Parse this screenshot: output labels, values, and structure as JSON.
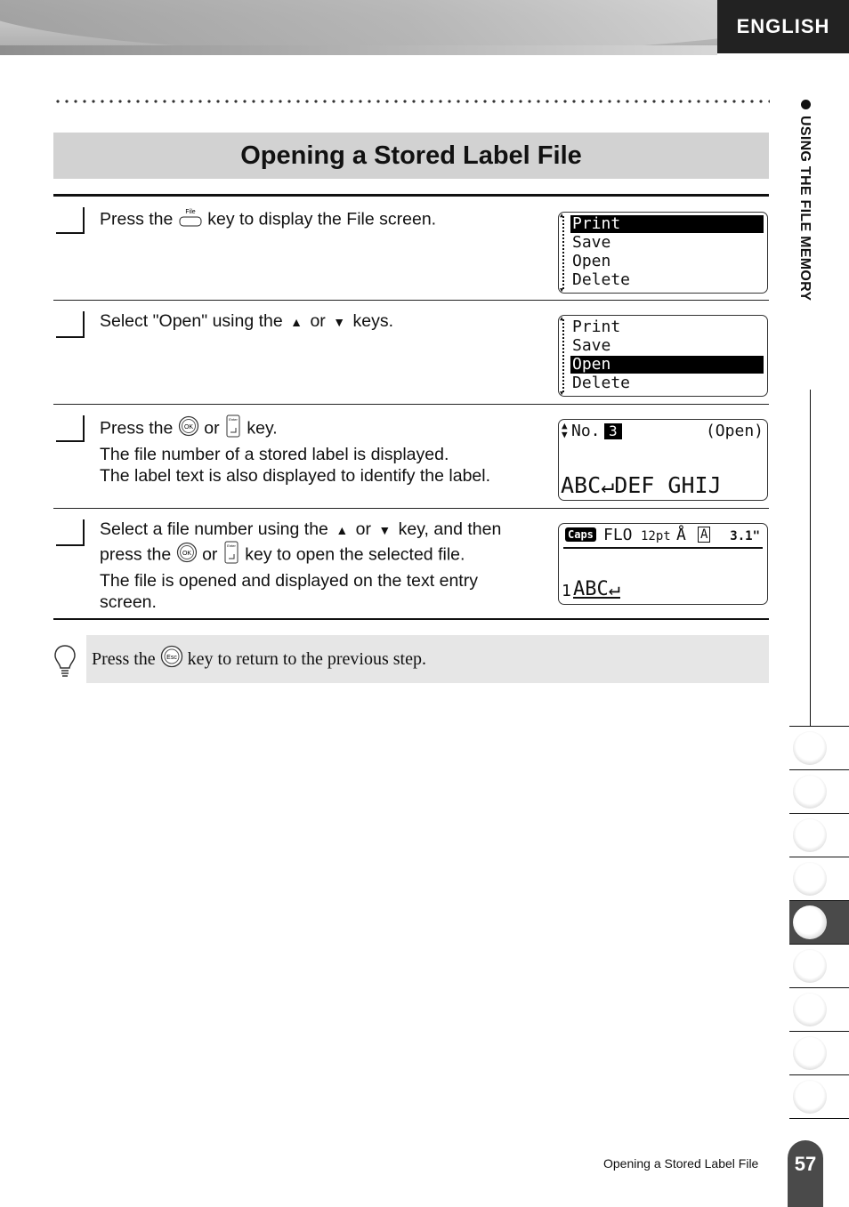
{
  "header": {
    "language": "ENGLISH"
  },
  "title": "Opening a Stored Label File",
  "side_section": "USING THE FILE MEMORY",
  "steps": [
    {
      "parts": [
        "Press the",
        "key to display the File screen."
      ],
      "key": "File"
    },
    {
      "parts": [
        "Select \"Open\" using the",
        "or",
        "keys."
      ]
    },
    {
      "line1": [
        "Press the",
        "or",
        "key."
      ],
      "line2": "The file number of a stored label is displayed.",
      "line3": "The label text is also displayed to identify the label."
    },
    {
      "line1": [
        "Select a file number using the",
        "or",
        "key, and then"
      ],
      "line2": [
        "press the",
        "or",
        "key to open the selected file."
      ],
      "line3": "The file is opened and displayed on the text entry",
      "line4": "screen."
    }
  ],
  "lcd1": {
    "items": [
      "Print",
      "Save",
      "Open",
      "Delete"
    ],
    "selected": "Print"
  },
  "lcd2": {
    "items": [
      "Print",
      "Save",
      "Open",
      "Delete"
    ],
    "selected": "Open"
  },
  "lcd3": {
    "no_label": "No.",
    "number": "3",
    "mode": "(Open)",
    "text": "ABC↵DEF GHIJ"
  },
  "lcd4": {
    "caps": "Caps",
    "font": "FLO",
    "size": "12pt",
    "length": "3.1\"",
    "text": "ABC↵",
    "line": "1"
  },
  "hint": {
    "before": "Press the",
    "key": "Esc",
    "after": "key to return to the previous step."
  },
  "keys": {
    "ok": "OK",
    "enter": "Enter",
    "file": "File"
  },
  "footer": {
    "text": "Opening a Stored Label File",
    "page": "57"
  },
  "tabs": {
    "count": 9,
    "active_index": 4
  }
}
